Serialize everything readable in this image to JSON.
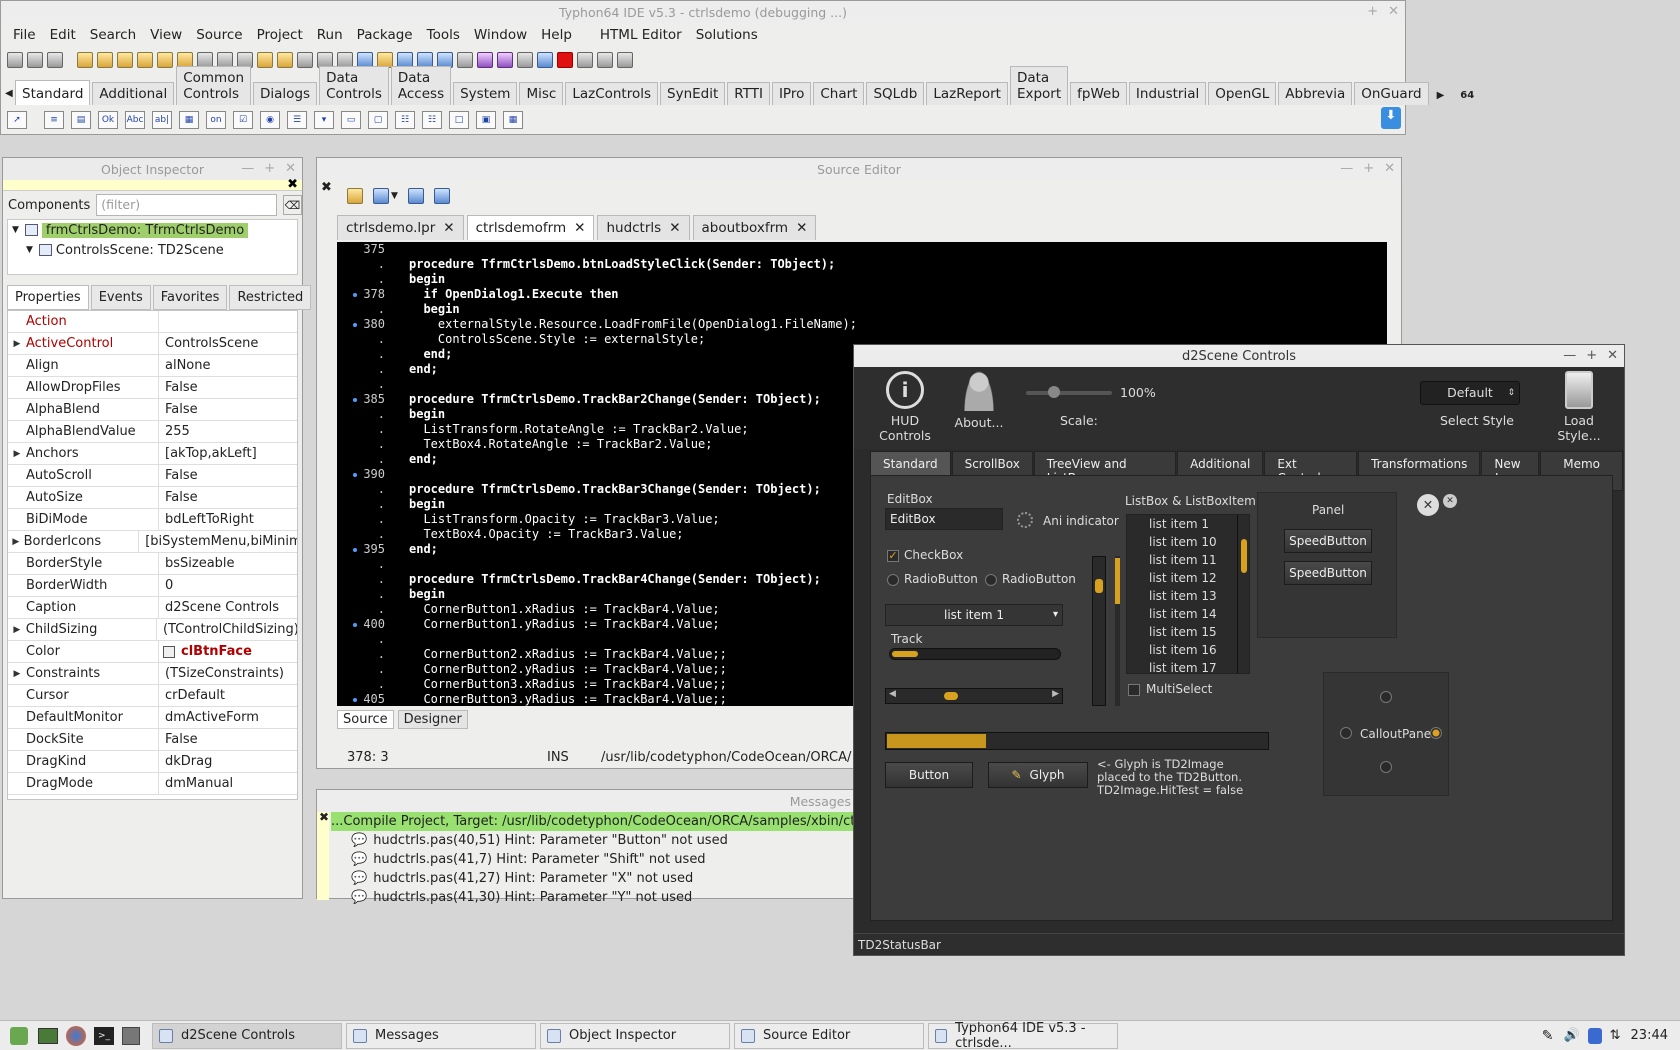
{
  "ide": {
    "title": "Typhon64 IDE v5.3 - ctrlsdemo (debugging ...)",
    "menu": [
      "File",
      "Edit",
      "Search",
      "View",
      "Source",
      "Project",
      "Run",
      "Package",
      "Tools",
      "Window",
      "Help",
      "HTML Editor",
      "Solutions"
    ],
    "palette_tabs": [
      "Standard",
      "Additional",
      "Common Controls",
      "Dialogs",
      "Data Controls",
      "Data Access",
      "System",
      "Misc",
      "LazControls",
      "SynEdit",
      "RTTI",
      "IPro",
      "Chart",
      "SQLdb",
      "LazReport",
      "Data Export",
      "fpWeb",
      "Industrial",
      "OpenGL",
      "Abbrevia",
      "OnGuard"
    ],
    "arch_badge": "64"
  },
  "object_inspector": {
    "title": "Object Inspector",
    "components_label": "Components",
    "filter_placeholder": "(filter)",
    "tree": [
      "frmCtrlsDemo: TfrmCtrlsDemo",
      "ControlsScene: TD2Scene"
    ],
    "tabs": [
      "Properties",
      "Events",
      "Favorites",
      "Restricted"
    ],
    "properties": [
      {
        "name": "Action",
        "value": ""
      },
      {
        "name": "ActiveControl",
        "value": "ControlsScene"
      },
      {
        "name": "Align",
        "value": "alNone"
      },
      {
        "name": "AllowDropFiles",
        "value": "False"
      },
      {
        "name": "AlphaBlend",
        "value": "False"
      },
      {
        "name": "AlphaBlendValue",
        "value": "255"
      },
      {
        "name": "Anchors",
        "value": "[akTop,akLeft]"
      },
      {
        "name": "AutoScroll",
        "value": "False"
      },
      {
        "name": "AutoSize",
        "value": "False"
      },
      {
        "name": "BiDiMode",
        "value": "bdLeftToRight"
      },
      {
        "name": "BorderIcons",
        "value": "[biSystemMenu,biMinimize"
      },
      {
        "name": "BorderStyle",
        "value": "bsSizeable"
      },
      {
        "name": "BorderWidth",
        "value": "0"
      },
      {
        "name": "Caption",
        "value": "d2Scene Controls"
      },
      {
        "name": "ChildSizing",
        "value": "(TControlChildSizing)"
      },
      {
        "name": "Color",
        "value": "clBtnFace"
      },
      {
        "name": "Constraints",
        "value": "(TSizeConstraints)"
      },
      {
        "name": "Cursor",
        "value": "crDefault"
      },
      {
        "name": "DefaultMonitor",
        "value": "dmActiveForm"
      },
      {
        "name": "DockSite",
        "value": "False"
      },
      {
        "name": "DragKind",
        "value": "dkDrag"
      },
      {
        "name": "DragMode",
        "value": "dmManual"
      }
    ]
  },
  "source_editor": {
    "title": "Source Editor",
    "tabs": [
      "ctrlsdemo.lpr",
      "ctrlsdemofrm",
      "hudctrls",
      "aboutboxfrm"
    ],
    "lines": [
      {
        "n": "375",
        "t": ""
      },
      {
        "n": ".",
        "t": "procedure TfrmCtrlsDemo.btnLoadStyleClick(Sender: TObject);"
      },
      {
        "n": ".",
        "t": "begin"
      },
      {
        "n": "378",
        "t": "  if OpenDialog1.Execute then"
      },
      {
        "n": ".",
        "t": "  begin"
      },
      {
        "n": "380",
        "t": "    externalStyle.Resource.LoadFromFile(OpenDialog1.FileName);"
      },
      {
        "n": ".",
        "t": "    ControlsScene.Style := externalStyle;"
      },
      {
        "n": ".",
        "t": "  end;"
      },
      {
        "n": ".",
        "t": "end;"
      },
      {
        "n": ".",
        "t": ""
      },
      {
        "n": "385",
        "t": "procedure TfrmCtrlsDemo.TrackBar2Change(Sender: TObject);"
      },
      {
        "n": ".",
        "t": "begin"
      },
      {
        "n": ".",
        "t": "  ListTransform.RotateAngle := TrackBar2.Value;"
      },
      {
        "n": ".",
        "t": "  TextBox4.RotateAngle := TrackBar2.Value;"
      },
      {
        "n": ".",
        "t": "end;"
      },
      {
        "n": "390",
        "t": ""
      },
      {
        "n": ".",
        "t": "procedure TfrmCtrlsDemo.TrackBar3Change(Sender: TObject);"
      },
      {
        "n": ".",
        "t": "begin"
      },
      {
        "n": ".",
        "t": "  ListTransform.Opacity := TrackBar3.Value;"
      },
      {
        "n": ".",
        "t": "  TextBox4.Opacity := TrackBar3.Value;"
      },
      {
        "n": "395",
        "t": "end;"
      },
      {
        "n": ".",
        "t": ""
      },
      {
        "n": ".",
        "t": "procedure TfrmCtrlsDemo.TrackBar4Change(Sender: TObject);"
      },
      {
        "n": ".",
        "t": "begin"
      },
      {
        "n": ".",
        "t": "  CornerButton1.xRadius := TrackBar4.Value;"
      },
      {
        "n": "400",
        "t": "  CornerButton1.yRadius := TrackBar4.Value;"
      },
      {
        "n": ".",
        "t": ""
      },
      {
        "n": ".",
        "t": "  CornerButton2.xRadius := TrackBar4.Value;;"
      },
      {
        "n": ".",
        "t": "  CornerButton2.yRadius := TrackBar4.Value;;"
      },
      {
        "n": ".",
        "t": "  CornerButton3.xRadius := TrackBar4.Value;;"
      },
      {
        "n": "405",
        "t": "  CornerButton3.yRadius := TrackBar4.Value;;"
      }
    ],
    "bottom_tabs": [
      "Source",
      "Designer"
    ],
    "status_pos": "378:  3",
    "status_mode": "INS",
    "status_path": "/usr/lib/codetyphon/CodeOcean/ORCA/"
  },
  "messages": {
    "title": "Messages",
    "compile": "...Compile Project, Target: /usr/lib/codetyphon/CodeOcean/ORCA/samples/xbin/ctrlsdemo: Suc",
    "hints": [
      "hudctrls.pas(40,51) Hint: Parameter \"Button\" not used",
      "hudctrls.pas(41,7) Hint: Parameter \"Shift\" not used",
      "hudctrls.pas(41,27) Hint: Parameter \"X\" not used",
      "hudctrls.pas(41,30) Hint: Parameter \"Y\" not used"
    ]
  },
  "d2scene": {
    "title": "d2Scene Controls",
    "hud_controls": "HUD Controls",
    "about": "About...",
    "scale_label": "Scale:",
    "scale_value": "100%",
    "style_value": "Default",
    "select_style": "Select Style",
    "load_style": "Load Style...",
    "tabs": [
      "Standard",
      "ScrollBox",
      "TreeView and ListBox",
      "Additional",
      "Ext Controls",
      "Transformations",
      "New !",
      "Memo"
    ],
    "editbox_label": "EditBox",
    "editbox_value": "EditBox",
    "ani_indicator": "Ani indicator",
    "checkbox": "CheckBox",
    "radio1": "RadioButton",
    "radio2": "RadioButton",
    "combo_value": "list item 1",
    "track_label": "Track",
    "listbox_label": "ListBox & ListBoxItem",
    "list_items": [
      "list item 1",
      "list item 10",
      "list item 11",
      "list item 12",
      "list item 13",
      "list item 14",
      "list item 15",
      "list item 16",
      "list item 17"
    ],
    "multiselect": "MultiSelect",
    "panel_label": "Panel",
    "speed1": "SpeedButton",
    "speed2": "SpeedButton",
    "callout": "CalloutPanel",
    "button": "Button",
    "glyph": "Glyph",
    "glyph_note": "<- Glyph is TD2Image\nplaced to the TD2Button.\nTD2Image.HitTest = false",
    "statusbar": "TD2StatusBar",
    "progress": 0.26
  },
  "taskbar": {
    "items": [
      "d2Scene Controls",
      "Messages",
      "Object Inspector",
      "Source Editor",
      "Typhon64 IDE v5.3 - ctrlsde..."
    ],
    "clock": "23:44"
  },
  "colors": {
    "accent": "#d9a21e",
    "highlight_green": "#98e070",
    "code_bg": "#000000",
    "selected_row": "#9fcf6a"
  }
}
